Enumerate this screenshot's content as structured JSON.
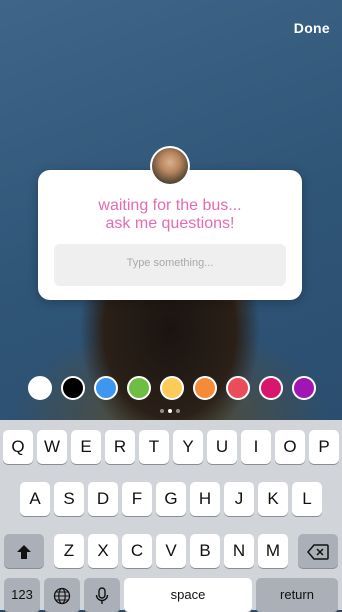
{
  "header": {
    "done_label": "Done"
  },
  "question_card": {
    "line1": "waiting for the bus...",
    "line2": "ask me questions!",
    "reply_placeholder": "Type something...",
    "text_color": "#e66bb1"
  },
  "color_palette": [
    "#ffffff",
    "#000000",
    "#3d97f0",
    "#6fbe44",
    "#fdcb5a",
    "#f58a38",
    "#ea4c5a",
    "#d8166e",
    "#a015b4"
  ],
  "keyboard": {
    "row1": [
      "Q",
      "W",
      "E",
      "R",
      "T",
      "Y",
      "U",
      "I",
      "O",
      "P"
    ],
    "row2": [
      "A",
      "S",
      "D",
      "F",
      "G",
      "H",
      "J",
      "K",
      "L"
    ],
    "row3": [
      "Z",
      "X",
      "C",
      "V",
      "B",
      "N",
      "M"
    ],
    "numbers_label": "123",
    "space_label": "space",
    "return_label": "return",
    "icons": {
      "shift": "shift-arrow-icon",
      "delete": "backspace-icon",
      "globe": "globe-icon",
      "mic": "microphone-icon"
    }
  }
}
